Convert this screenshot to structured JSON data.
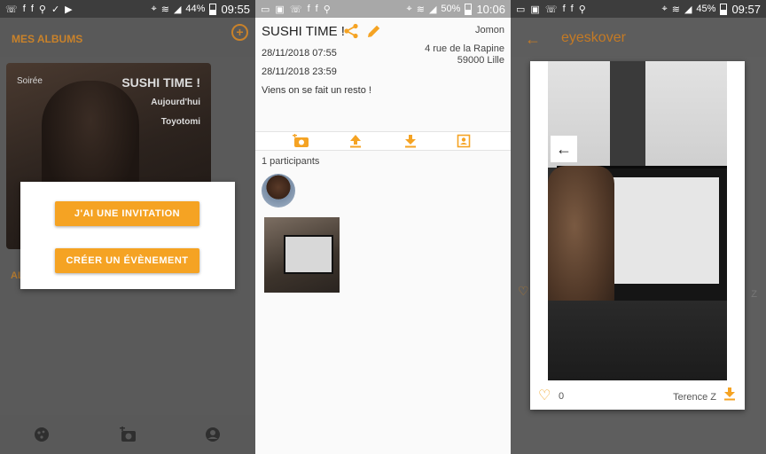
{
  "status_left": {
    "icons": [
      "whatsapp-icon",
      "facebook-icon",
      "facebook-icon",
      "usb-icon",
      "check-icon",
      "play-store-icon"
    ],
    "battery": "44%",
    "time": "09:55"
  },
  "status_mid": {
    "battery": "50%",
    "time": "10:06"
  },
  "status_right": {
    "battery": "45%",
    "time": "09:57"
  },
  "panel1": {
    "title": "MES ALBUMS",
    "add_icon": "add-circle-icon",
    "album": {
      "tag": "Soirée",
      "name": "SUSHI TIME !",
      "when": "Aujourd'hui",
      "where": "Toyotomi"
    },
    "faded_label": "AL",
    "dialog": {
      "invite_label": "J'AI UNE INVITATION",
      "create_label": "CRÉER UN ÉVÈNEMENT"
    },
    "nav": [
      "pizza-icon",
      "add-photo-icon",
      "account-icon"
    ]
  },
  "panel2": {
    "title": "SUSHI TIME !",
    "owner": "Jomon",
    "start": "28/11/2018 07:55",
    "end": "28/11/2018 23:59",
    "address_line1": "4 rue de la Rapine",
    "address_line2": "59000 Lille",
    "description": "Viens on se fait un resto !",
    "participants": "1 participants",
    "accent": "#f5a323"
  },
  "panel3": {
    "title": "eyeskover",
    "likes": "0",
    "author": "Terence Z",
    "ghost_author": "Z"
  }
}
